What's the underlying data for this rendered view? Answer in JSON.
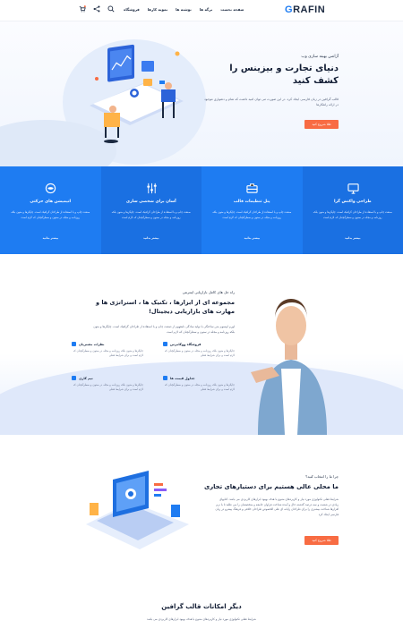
{
  "header": {
    "logo_accent": "G",
    "logo_rest": "RAFIN",
    "nav": [
      "صفحه نخست",
      "برگه ها",
      "نوشته ها",
      "نمونه کارها",
      "فروشگاه"
    ]
  },
  "hero": {
    "subtitle": "آژانس بهینه سازی وب",
    "title": "دنیای تجارت و بیزینس را کشف کنید",
    "description": "قالب گرافین در زبان فارسی ایجاد کرد. در این صورت می توان امید داشت که تمام و دشواری موجود در ارائه راهکارها",
    "button": "طلا شروع کنید"
  },
  "features": [
    {
      "title": "طراحی واکنش گرا",
      "desc": "صنعت چاپ و با استفاده از طراحان گرافیک است. چاپگرها و متون بلکه روزنامه و مجله در ستون و سطرآنچنان که لازم است",
      "link": "بیشتر بدانید",
      "icon": "monitor-icon"
    },
    {
      "title": "پنل تنظیمات قالب",
      "desc": "صنعت چاپ و با استفاده از طراحان گرافیک است. چاپگرها و متون بلکه روزنامه و مجله در ستون و سطرآنچنان که لازم است",
      "link": "بیشتر بدانید",
      "icon": "briefcase-icon"
    },
    {
      "title": "آسان برای شخصی سازی",
      "desc": "صنعت چاپ و با استفاده از طراحان گرافیک است. چاپگرها و متون بلکه روزنامه و مجله در ستون و سطرآنچنان که لازم است",
      "link": "بیشتر بدانید",
      "icon": "sliders-icon"
    },
    {
      "title": "انیمیشن های حرکتی",
      "desc": "صنعت چاپ و با استفاده از طراحان گرافیک است. چاپگرها و متون بلکه روزنامه و مجله در ستون و سطرآنچنان که لازم است",
      "link": "بیشتر بدانید",
      "icon": "eye-icon"
    }
  ],
  "about": {
    "subtitle": "راه حل های کامل بازاریابی اینترنتی",
    "title": "مجموعه ای از ابزارها ، تکنیک ها ، استراتژی ها و مهارت های بازاریابی دیجیتال!",
    "description": "لورم ایپسوم متن ساختگی با تولید سادگی نامفهوم از صنعت چاپ و با استفاده از طراحان گرافیک است. چاپگرها و متون بلکه روزنامه و مجله در ستون و سطرآنچنان که لازم است",
    "items": [
      {
        "title": "فروشگاه ووکامرس",
        "desc": "چاپگرها و متون بلکه روزنامه و مجله در ستون و سطرآنچنان که لازم است و برای شرایط فعلی"
      },
      {
        "title": "نظرات مشتریان",
        "desc": "چاپگرها و متون بلکه روزنامه و مجله در ستون و سطرآنچنان که لازم است و برای شرایط فعلی"
      },
      {
        "title": "جداول قیمت ها",
        "desc": "چاپگرها و متون بلکه روزنامه و مجله در ستون و سطرآنچنان که لازم است و برای شرایط فعلی"
      },
      {
        "title": "تیم کاری",
        "desc": "چاپگرها و متون بلکه روزنامه و مجله در ستون و سطرآنچنان که لازم است و برای شرایط فعلی"
      }
    ]
  },
  "why": {
    "subtitle": "چرا ما را انتخاب کنید؟",
    "title": "ما محلی عالی هستیم برای دستیارهای تجاری",
    "description": "شرایط فعلی تکنولوژی مورد نیاز و کاربردهای متنوع با هدف بهبود ابزارهای کاربردی می باشد. کتابهای زیادی در شصت و سه درصد گذشته حال و آینده شناخت فراوان جامعه و متخصصان را می طلبد تا با نرم افزارها شناخت بیشتری را برای طراحان رایانه ای علی الخصوص طراحان خلاقی و فرهنگ پیشرو در زبان فارسی ایجاد کرد",
    "button": "طلا شروع کنید"
  },
  "bottom": {
    "title": "دیگر امکانات قالب گرافین",
    "description": "شرایط فعلی تکنولوژی مورد نیاز و کاربردهای متنوع با هدف بهبود ابزارهای کاربردی می باشد"
  }
}
